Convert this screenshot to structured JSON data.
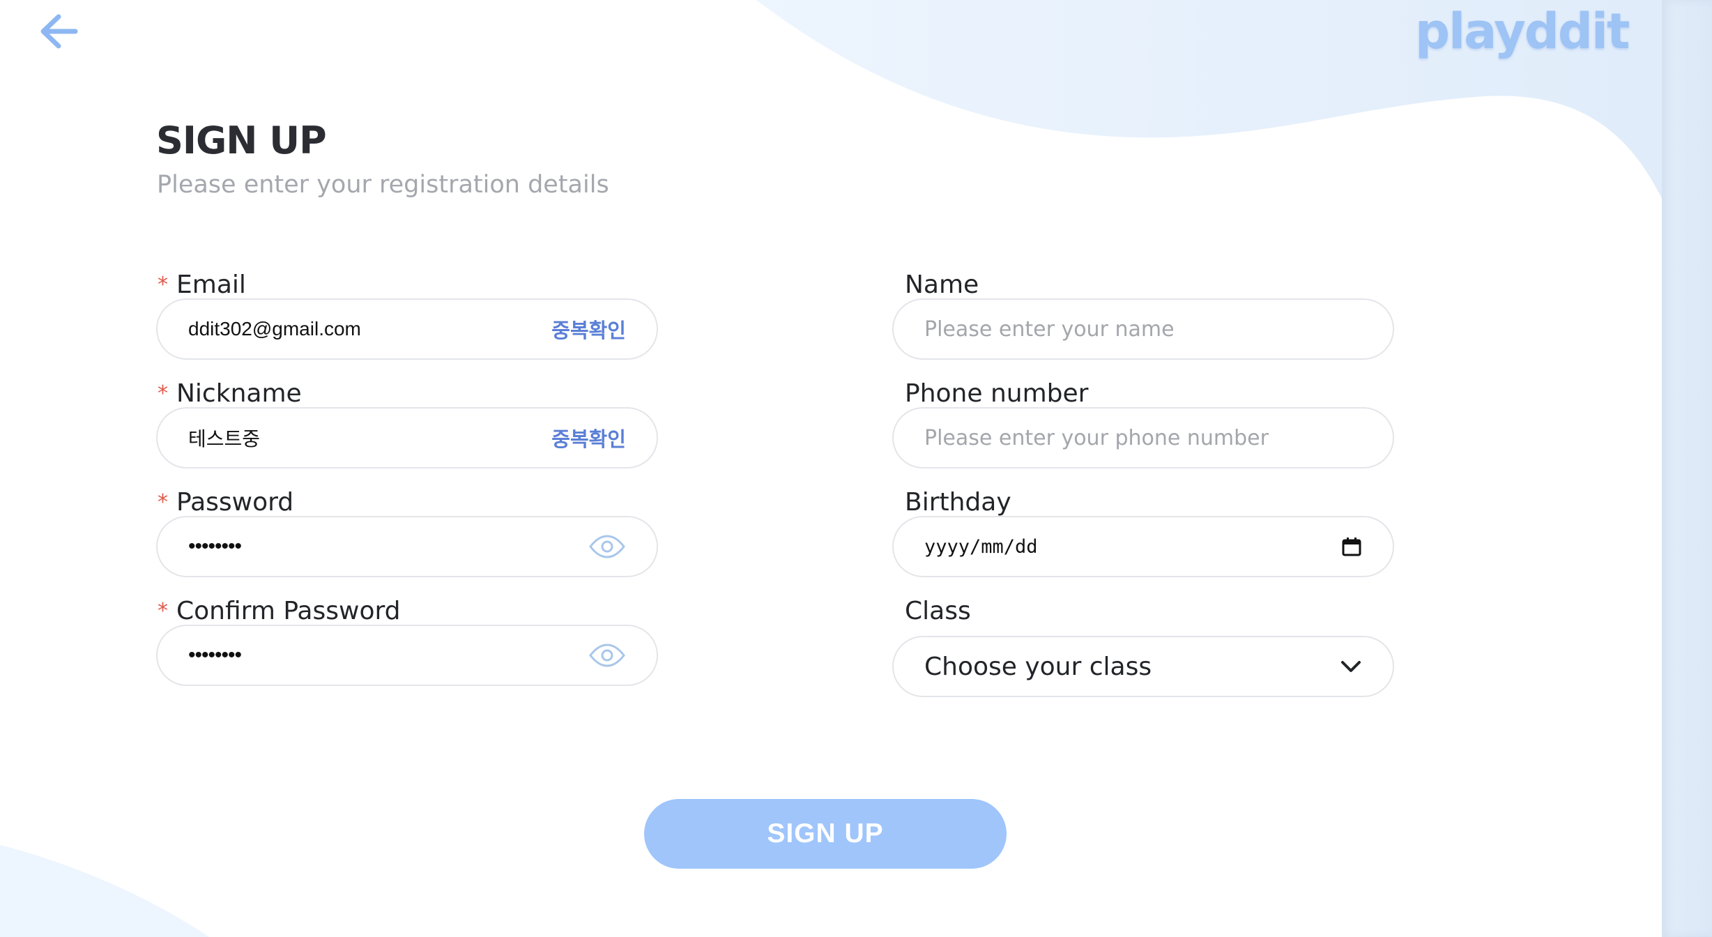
{
  "header": {
    "logo_text": "playddit",
    "title": "SIGN UP",
    "subtitle": "Please enter your registration details"
  },
  "icons": {
    "back": "arrow-left-icon",
    "password_toggle": "eye-icon",
    "calendar": "calendar-icon",
    "dropdown": "chevron-down-icon"
  },
  "form": {
    "required_mark": "*",
    "email": {
      "label": "Email",
      "value": "ddit302@gmail.com",
      "check_label": "중복확인"
    },
    "nickname": {
      "label": "Nickname",
      "value": "테스트중",
      "check_label": "중복확인"
    },
    "password": {
      "label": "Password",
      "value": "••••••••"
    },
    "confirm_password": {
      "label": "Confirm Password",
      "value": "••••••••"
    },
    "name": {
      "label": "Name",
      "placeholder": "Please enter your name"
    },
    "phone": {
      "label": "Phone number",
      "placeholder": "Please enter your phone number"
    },
    "birthday": {
      "label": "Birthday",
      "value": "yyyy/mm/dd"
    },
    "class": {
      "label": "Class",
      "selected": "Choose your class"
    },
    "submit_label": "SIGN UP"
  },
  "colors": {
    "accent": "#5a7fd6",
    "button": "#9fc5fb",
    "required": "#e2584a",
    "wave": "#e8f2fd",
    "logo": "#9ec3f5"
  }
}
